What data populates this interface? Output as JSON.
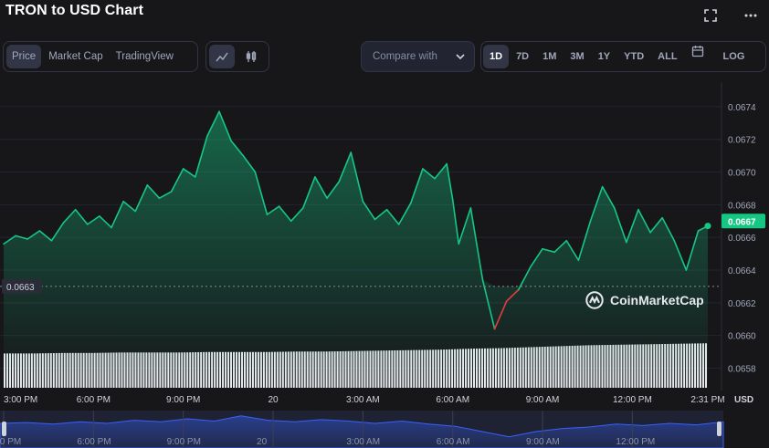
{
  "title": "TRON to USD Chart",
  "icons": {
    "fullscreen": "fullscreen-icon",
    "more": "more-icon"
  },
  "view_tabs": [
    "Price",
    "Market Cap",
    "TradingView"
  ],
  "active_view": "Price",
  "chart_type_buttons": [
    "line-chart-icon",
    "candlestick-icon"
  ],
  "compare_label": "Compare with",
  "ranges": [
    "1D",
    "7D",
    "1M",
    "3M",
    "1Y",
    "YTD",
    "ALL"
  ],
  "active_range": "1D",
  "log_label": "LOG",
  "currency_label": "USD",
  "watermark": "CoinMarketCap",
  "colors": {
    "up": "#16c784",
    "down": "#ea3943",
    "current_badge": "#16c784",
    "background": "#17171a"
  },
  "chart_data": {
    "type": "line",
    "y_ticks": [
      "0.0674",
      "0.0672",
      "0.0670",
      "0.0668",
      "0.0666",
      "0.0664",
      "0.0662",
      "0.0660",
      "0.0658"
    ],
    "ylim": [
      0.06568,
      0.06755
    ],
    "x_ticks": [
      "3:00 PM",
      "6:00 PM",
      "9:00 PM",
      "20",
      "3:00 AM",
      "6:00 AM",
      "9:00 AM",
      "12:00 PM",
      "2:31 PM"
    ],
    "x_tick_hours": [
      0,
      3,
      6,
      9,
      12,
      15,
      18,
      21,
      23.52
    ],
    "baseline_value": 0.0663,
    "baseline_label": "0.0663",
    "current_value": 0.0667,
    "current_label": "0.0667",
    "series": [
      {
        "x": [
          0,
          0.4,
          0.8,
          1.2,
          1.6,
          2,
          2.4,
          2.8,
          3.2,
          3.6,
          4,
          4.4,
          4.8,
          5.2,
          5.6,
          6,
          6.4,
          6.8,
          7.2,
          7.6,
          8,
          8.4,
          8.8,
          9.2,
          9.6,
          10,
          10.4,
          10.8,
          11.2,
          11.6,
          12,
          12.4,
          12.8,
          13.2,
          13.6,
          14,
          14.4,
          14.8,
          15,
          15.2,
          15.6,
          16,
          16.4,
          16.8,
          17.2,
          17.6,
          18,
          18.4,
          18.8,
          19.2,
          19.6,
          20,
          20.4,
          20.8,
          21.2,
          21.6,
          22,
          22.4,
          22.8,
          23.2,
          23.52
        ],
        "values": [
          0.06656,
          0.06661,
          0.06659,
          0.06664,
          0.06658,
          0.06669,
          0.06677,
          0.06668,
          0.06673,
          0.06666,
          0.06682,
          0.06676,
          0.06692,
          0.06684,
          0.06688,
          0.06702,
          0.06697,
          0.06722,
          0.06737,
          0.06719,
          0.0671,
          0.067,
          0.06674,
          0.06679,
          0.0667,
          0.06678,
          0.06697,
          0.06684,
          0.06694,
          0.06712,
          0.06682,
          0.06671,
          0.06677,
          0.06668,
          0.06681,
          0.06702,
          0.06696,
          0.06705,
          0.06683,
          0.06656,
          0.06678,
          0.06634,
          0.06604,
          0.06621,
          0.06628,
          0.06642,
          0.06653,
          0.06651,
          0.06658,
          0.06646,
          0.0667,
          0.06691,
          0.06678,
          0.06657,
          0.06677,
          0.06663,
          0.06672,
          0.06658,
          0.0664,
          0.06664,
          0.06667
        ]
      }
    ],
    "volume": [
      0.71,
      0.71,
      0.72,
      0.72,
      0.73,
      0.73,
      0.73,
      0.74,
      0.74,
      0.74,
      0.75,
      0.75,
      0.76,
      0.77,
      0.78,
      0.79,
      0.81,
      0.82,
      0.84,
      0.86,
      0.88,
      0.89,
      0.9,
      0.91,
      0.92
    ]
  },
  "navigator": {
    "labels": [
      "3:00 PM",
      "6:00 PM",
      "9:00 PM",
      "20",
      "3:00 AM",
      "6:00 AM",
      "9:00 AM",
      "12:00 PM"
    ],
    "values": [
      0.66,
      0.68,
      0.64,
      0.7,
      0.66,
      0.74,
      0.7,
      0.78,
      0.72,
      0.86,
      0.74,
      0.7,
      0.76,
      0.72,
      0.66,
      0.72,
      0.64,
      0.58,
      0.44,
      0.3,
      0.44,
      0.52,
      0.56,
      0.64,
      0.6,
      0.66,
      0.62,
      0.7
    ]
  }
}
